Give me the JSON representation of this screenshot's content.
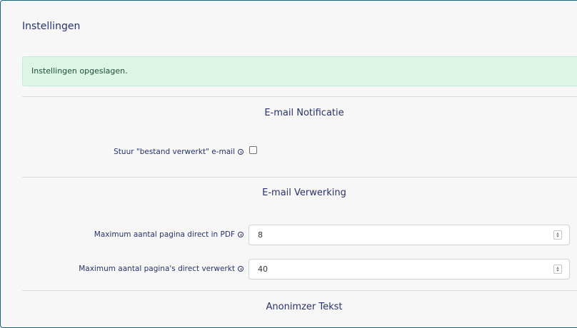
{
  "header": {
    "title": "Instellingen"
  },
  "alert": {
    "message": "Instellingen opgeslagen."
  },
  "sections": {
    "email_notification": {
      "title": "E-mail Notificatie",
      "send_processed_label": "Stuur \"bestand verwerkt\" e-mail",
      "send_processed_checked": false
    },
    "email_processing": {
      "title": "E-mail Verwerking",
      "max_pages_pdf_label": "Maximum aantal pagina direct in PDF",
      "max_pages_pdf_value": "8",
      "max_pages_processed_label": "Maximum aantal pagina's direct verwerkt",
      "max_pages_processed_value": "40"
    },
    "anonymizer": {
      "title": "Anonimzer Tekst"
    }
  },
  "icons": {
    "info": "info-icon",
    "spinner": "number-spinner-icon"
  },
  "colors": {
    "text": "#27326a",
    "panel_border": "#16637a",
    "alert_bg": "#dcf5e7",
    "alert_text": "#1f5134",
    "panel_bg": "#f7f7f7"
  }
}
